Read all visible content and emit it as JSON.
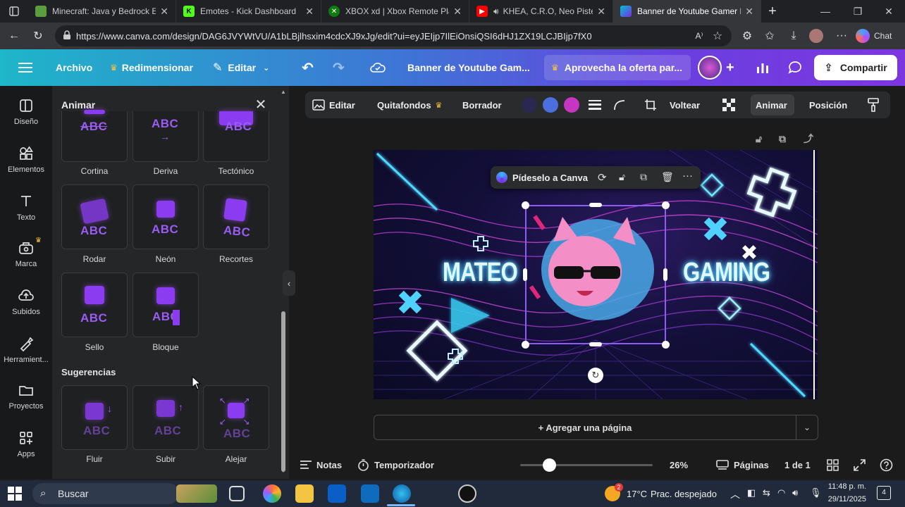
{
  "browser": {
    "tabs": [
      {
        "title": "Minecraft: Java y Bedrock Edition",
        "active": false
      },
      {
        "title": "Emotes - Kick Dashboard",
        "active": false
      },
      {
        "title": "XBOX xd | Xbox Remote Play c",
        "active": false
      },
      {
        "title": "KHEA, C.R.O, Neo Pistea",
        "active": false
      },
      {
        "title": "Banner de Youtube Gamer Ne",
        "active": true
      }
    ],
    "url": "https://www.canva.com/design/DAG6JVYWtVU/A1bLBjlhsxim4cdcXJ9xJg/edit?ui=eyJEIjp7IlEiOnsiQSI6dHJ1ZX19LCJBIjp7fX0",
    "chat_label": "Chat"
  },
  "canva_header": {
    "file_label": "Archivo",
    "resize_label": "Redimensionar",
    "edit_label": "Editar",
    "title": "Banner de Youtube Gam...",
    "offer_label": "Aprovecha la oferta par...",
    "share_label": "Compartir"
  },
  "rail": [
    {
      "label": "Diseño",
      "icon": "layout-icon"
    },
    {
      "label": "Elementos",
      "icon": "shapes-icon"
    },
    {
      "label": "Texto",
      "icon": "text-icon"
    },
    {
      "label": "Marca",
      "icon": "brand-icon"
    },
    {
      "label": "Subidos",
      "icon": "upload-icon"
    },
    {
      "label": "Herramient...",
      "icon": "tools-icon"
    },
    {
      "label": "Proyectos",
      "icon": "folder-icon"
    },
    {
      "label": "Apps",
      "icon": "apps-icon"
    }
  ],
  "panel": {
    "title": "Animar",
    "cards": [
      "Cortina",
      "Deriva",
      "Tectónico",
      "Rodar",
      "Neón",
      "Recortes",
      "Sello",
      "Bloque"
    ],
    "suggestions_title": "Sugerencias",
    "suggestions": [
      "Fluir",
      "Subir",
      "Alejar"
    ],
    "sample_text": "ABC"
  },
  "context_toolbar": {
    "edit_label": "Editar",
    "bg_remover_label": "Quitafondos",
    "eraser_label": "Borrador",
    "flip_label": "Voltear",
    "animate_label": "Animar",
    "position_label": "Posición",
    "colors": [
      "#2a2850",
      "#4c6fe0",
      "#c636c0"
    ]
  },
  "canvas": {
    "ask_canva_label": "Pídeselo a Canva",
    "text_left": "MATEO",
    "text_right": "GAMING",
    "add_page_label": "+ Agregar una página"
  },
  "footer": {
    "notes_label": "Notas",
    "timer_label": "Temporizador",
    "zoom": "26%",
    "zoom_fraction": 0.26,
    "pages_label": "Páginas",
    "page_count": "1 de 1"
  },
  "taskbar": {
    "search_label": "Buscar",
    "weather": "17°C",
    "weather_desc": "Prac. despejado",
    "time": "11:48 p. m.",
    "date": "29/11/2025",
    "notification_count": "4",
    "weather_badge": "2"
  }
}
